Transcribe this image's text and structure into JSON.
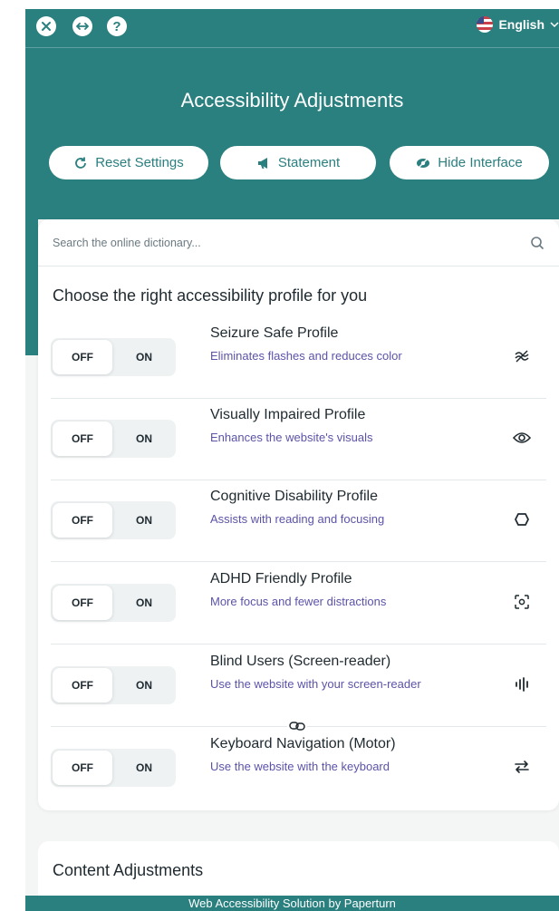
{
  "header": {
    "language": "English",
    "title": "Accessibility Adjustments",
    "help_glyph": "?"
  },
  "actions": {
    "reset_label": "Reset Settings",
    "statement_label": "Statement",
    "hide_label": "Hide Interface"
  },
  "search": {
    "placeholder": "Search the online dictionary..."
  },
  "profiles": {
    "title": "Choose the right accessibility profile for you",
    "items": [
      {
        "name": "Seizure Safe Profile",
        "description": "Eliminates flashes and reduces color",
        "off_label": "OFF",
        "on_label": "ON",
        "icon": "seizure-icon",
        "state": "off"
      },
      {
        "name": "Visually Impaired Profile",
        "description": "Enhances the website's visuals",
        "off_label": "OFF",
        "on_label": "ON",
        "icon": "eye-icon",
        "state": "off"
      },
      {
        "name": "Cognitive Disability Profile",
        "description": "Assists with reading and focusing",
        "off_label": "OFF",
        "on_label": "ON",
        "icon": "cognitive-icon",
        "state": "off"
      },
      {
        "name": "ADHD Friendly Profile",
        "description": "More focus and fewer distractions",
        "off_label": "OFF",
        "on_label": "ON",
        "icon": "focus-icon",
        "state": "off"
      },
      {
        "name": "Blind Users (Screen-reader)",
        "description": "Use the website with your screen-reader",
        "off_label": "OFF",
        "on_label": "ON",
        "icon": "audio-bars-icon",
        "state": "off"
      },
      {
        "name": "Keyboard Navigation (Motor)",
        "description": "Use the website with the keyboard",
        "off_label": "OFF",
        "on_label": "ON",
        "icon": "arrows-icon",
        "state": "off"
      }
    ]
  },
  "content_adjustments": {
    "title": "Content Adjustments"
  },
  "footer": {
    "text": "Web Accessibility Solution by Paperturn"
  },
  "colors": {
    "teal": "#2a7f7f",
    "description_purple": "#5b53a8",
    "panel_bg": "#f4f6f6"
  }
}
